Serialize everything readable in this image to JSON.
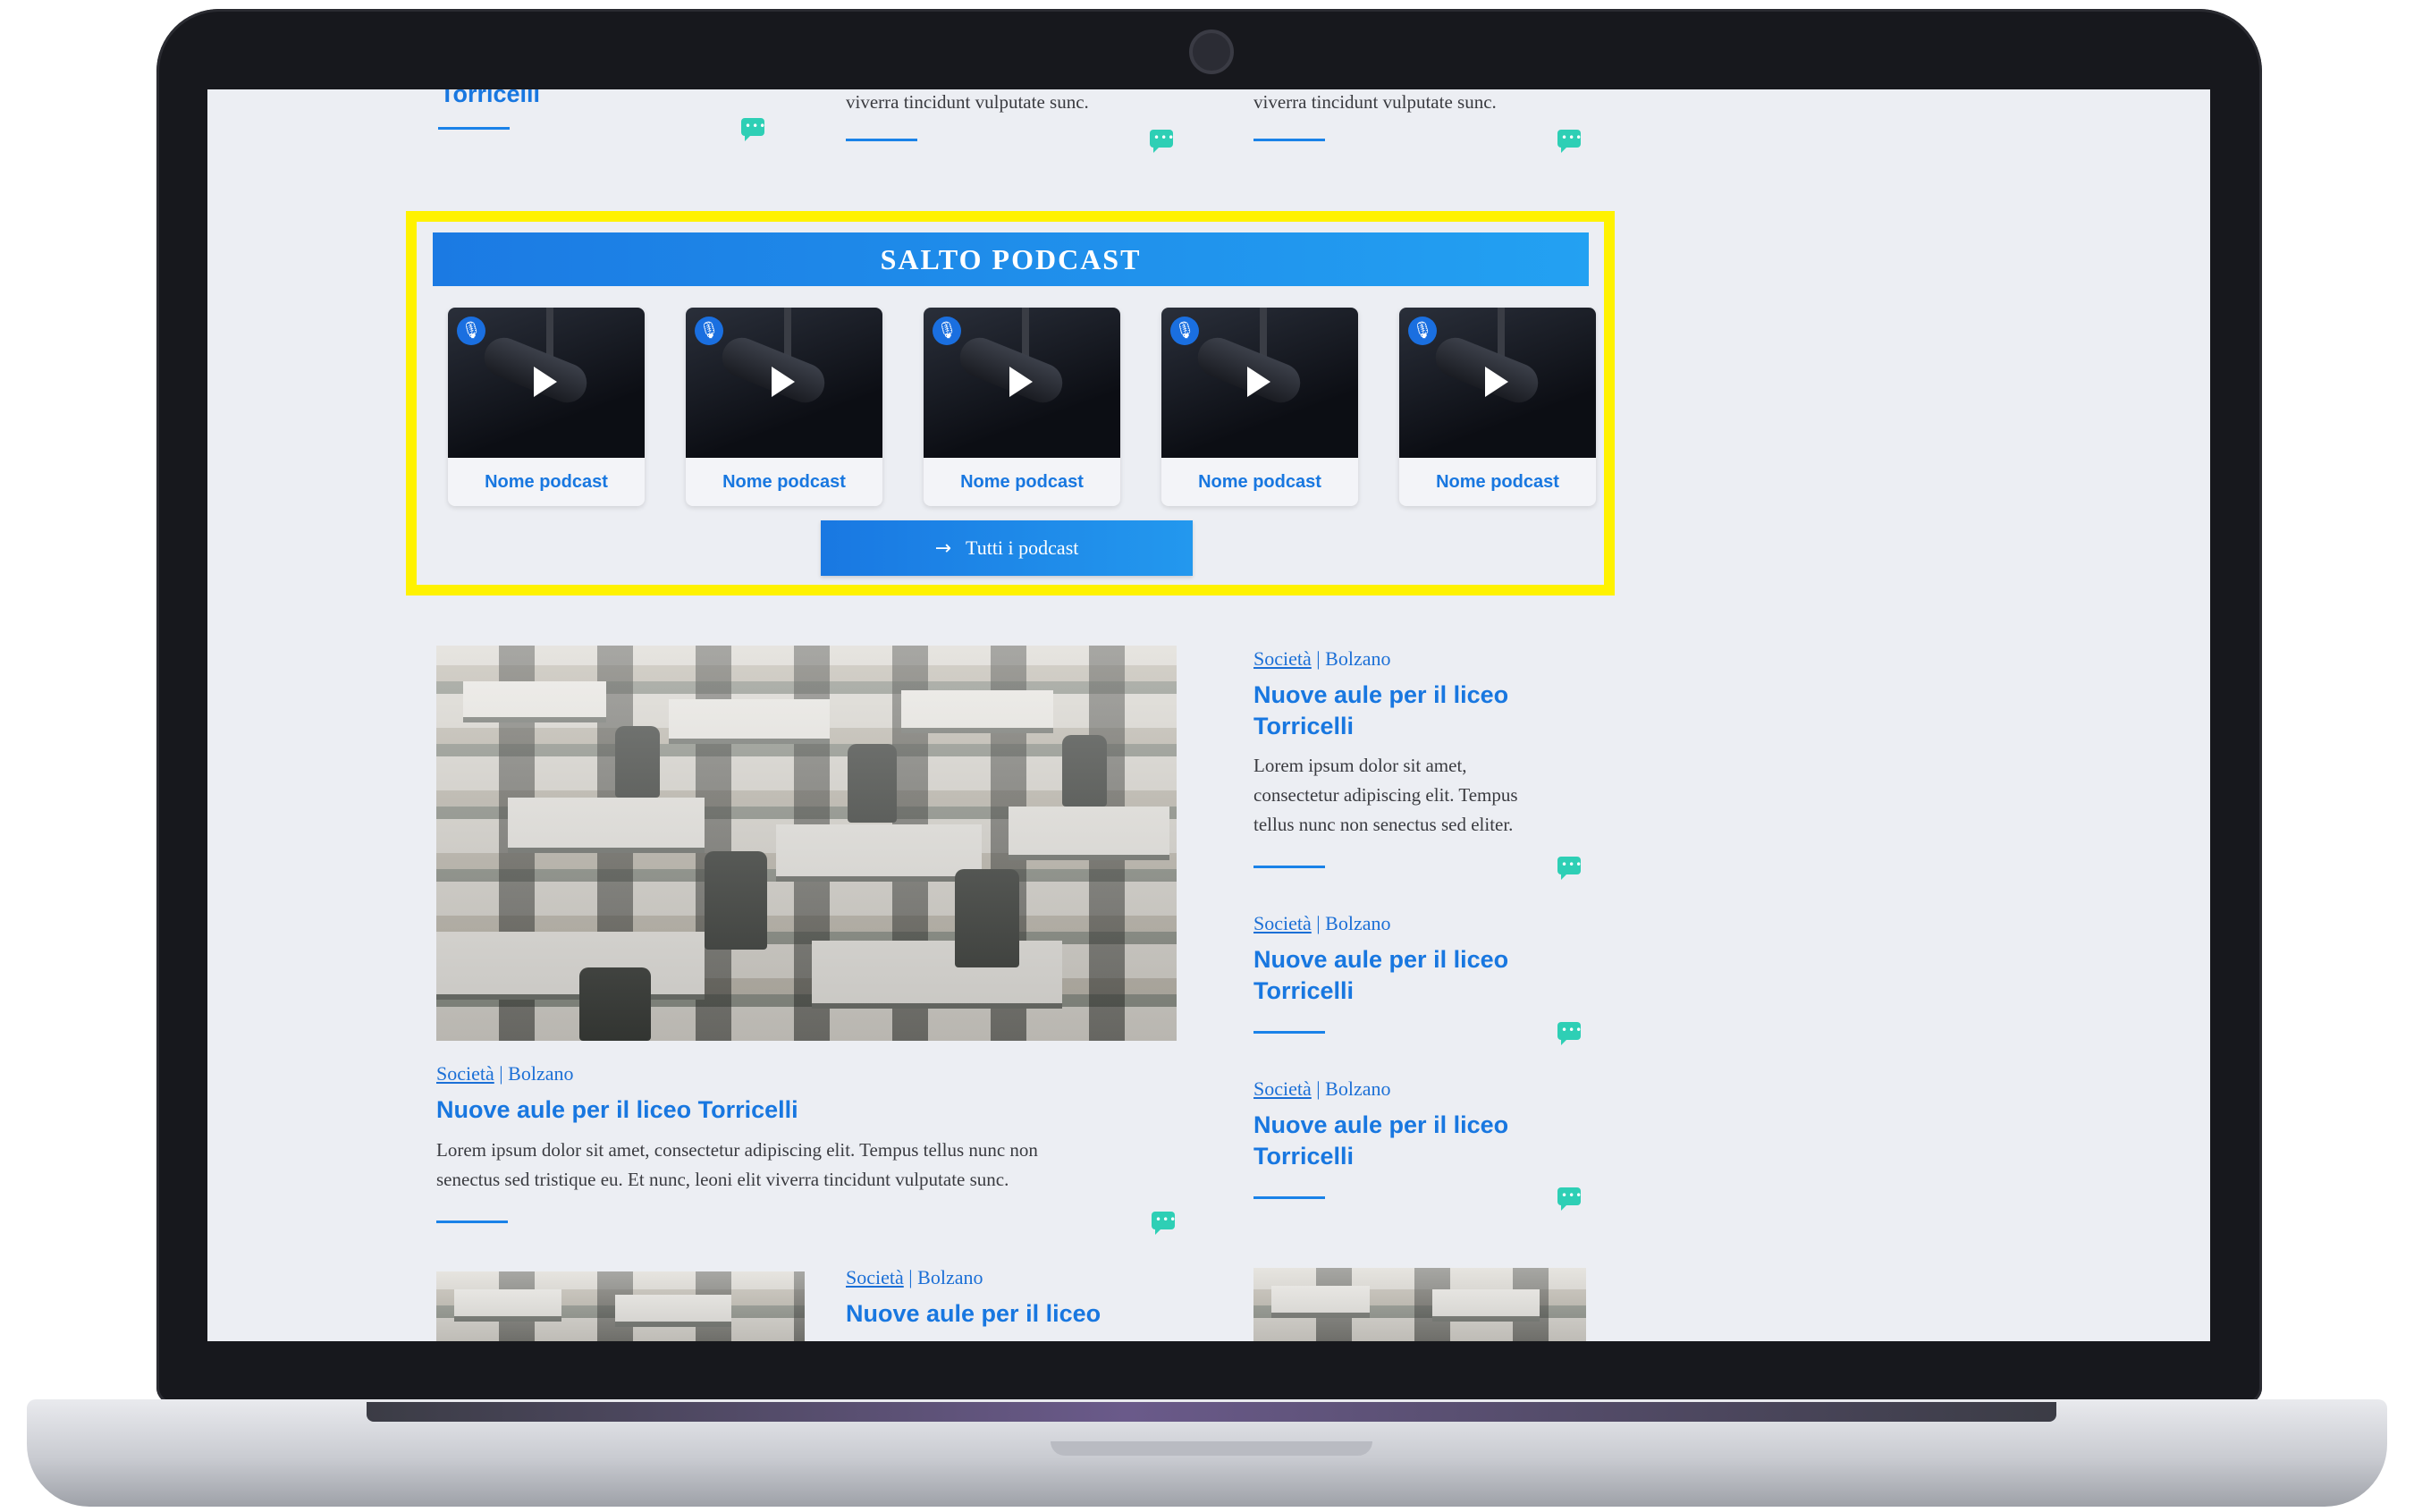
{
  "top_row": {
    "left_title_fragment": "Torricelli",
    "mid_excerpt_fragment": "viverra tincidunt vulputate sunc.",
    "right_excerpt_fragment": "viverra tincidunt vulputate sunc."
  },
  "podcast_section": {
    "title": "SALTO PODCAST",
    "cards": [
      {
        "label": "Nome podcast"
      },
      {
        "label": "Nome podcast"
      },
      {
        "label": "Nome podcast"
      },
      {
        "label": "Nome podcast"
      },
      {
        "label": "Nome podcast"
      }
    ],
    "all_button_label": "Tutti i podcast",
    "icons": {
      "mic": "microphone-icon",
      "play": "play-icon",
      "arrow": "arrow-right-icon"
    }
  },
  "main_article": {
    "category": "Società",
    "location": "Bolzano",
    "title": "Nuove aule per il liceo Torricelli",
    "excerpt_line1": "Lorem ipsum dolor sit amet, consectetur adipiscing elit. Tempus tellus nunc non",
    "excerpt_line2": "senectus sed tristique eu. Et nunc, leoni elit viverra tincidunt vulputate sunc."
  },
  "side_articles": [
    {
      "category": "Società",
      "location": "Bolzano",
      "title_line1": "Nuove aule per il liceo",
      "title_line2": "Torricelli",
      "excerpt_line1": "Lorem ipsum dolor sit amet,",
      "excerpt_line2": "consectetur adipiscing elit. Tempus",
      "excerpt_line3": "tellus nunc non senectus sed eliter."
    },
    {
      "category": "Società",
      "location": "Bolzano",
      "title_line1": "Nuove aule per il liceo",
      "title_line2": "Torricelli"
    },
    {
      "category": "Società",
      "location": "Bolzano",
      "title_line1": "Nuove aule per il liceo",
      "title_line2": "Torricelli"
    }
  ],
  "bottom_row": {
    "category": "Società",
    "location": "Bolzano",
    "title": "Nuove aule per il liceo"
  },
  "colors": {
    "accent": "#1877e0",
    "highlight": "#fff200",
    "comment": "#2ecfb5"
  }
}
